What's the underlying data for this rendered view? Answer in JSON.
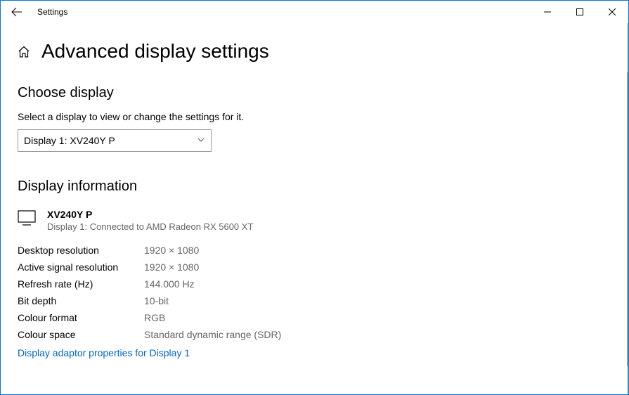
{
  "window": {
    "title": "Settings"
  },
  "page": {
    "title": "Advanced display settings"
  },
  "choose_display": {
    "heading": "Choose display",
    "subtext": "Select a display to view or change the settings for it.",
    "dropdown_value": "Display 1: XV240Y P"
  },
  "display_info": {
    "heading": "Display information",
    "device_name": "XV240Y P",
    "device_sub": "Display 1: Connected to AMD Radeon RX 5600 XT",
    "rows": [
      {
        "label": "Desktop resolution",
        "value": "1920 × 1080"
      },
      {
        "label": "Active signal resolution",
        "value": "1920 × 1080"
      },
      {
        "label": "Refresh rate (Hz)",
        "value": "144.000 Hz"
      },
      {
        "label": "Bit depth",
        "value": "10-bit"
      },
      {
        "label": "Colour format",
        "value": "RGB"
      },
      {
        "label": "Colour space",
        "value": "Standard dynamic range (SDR)"
      }
    ],
    "adaptor_link": "Display adaptor properties for Display 1"
  }
}
